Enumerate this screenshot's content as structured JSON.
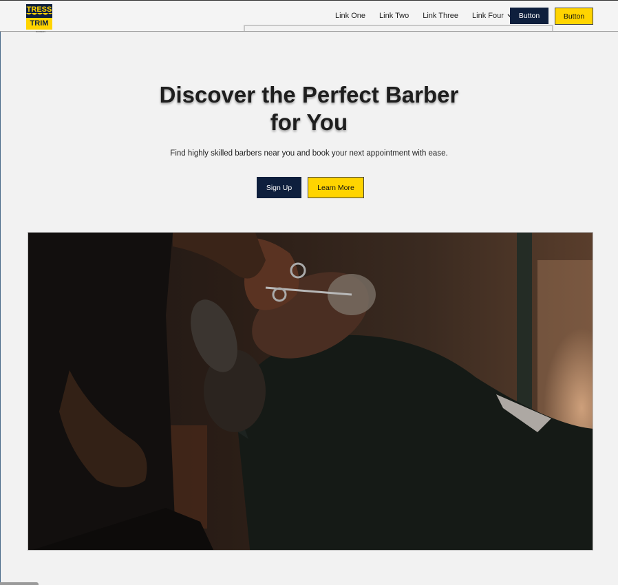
{
  "brand": {
    "logo_line1": "TRESS",
    "logo_line2": "TRIM",
    "logo_tagline": "BARBERS",
    "colors": {
      "navy": "#0e1f3d",
      "yellow": "#ffd400"
    }
  },
  "nav": {
    "links": [
      "Link One",
      "Link Two",
      "Link Three"
    ],
    "dropdown_label": "Link Four",
    "button_primary": "Button",
    "button_secondary": "Button"
  },
  "hero": {
    "title_line1": "Discover the Perfect Barber",
    "title_line2": "for You",
    "subtitle": "Find highly skilled barbers near you and book your next appointment with ease.",
    "cta_primary": "Sign Up",
    "cta_secondary": "Learn More"
  },
  "image": {
    "subject": "barber-trimming-beard-photo"
  }
}
